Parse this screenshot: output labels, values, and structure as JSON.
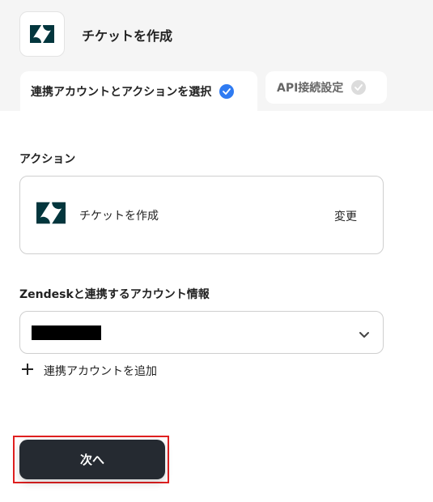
{
  "header": {
    "title": "チケットを作成",
    "app_icon": "zendesk-logo-icon",
    "brand_color": "#03363d"
  },
  "tabs": [
    {
      "label": "連携アカウントとアクションを選択",
      "state": "active",
      "check_color": "#2f7bf2"
    },
    {
      "label": "API接続設定",
      "state": "inactive",
      "check_color": "#dcdcdc"
    }
  ],
  "action": {
    "section_label": "アクション",
    "name": "チケットを作成",
    "change_label": "変更",
    "icon": "zendesk-logo-icon"
  },
  "account": {
    "section_label": "Zendeskと連携するアカウント情報",
    "selected_value_redacted": true,
    "add_label": "連携アカウントを追加"
  },
  "footer": {
    "next_label": "次へ",
    "next_color": "#252a31",
    "highlight_color": "#e02020"
  }
}
